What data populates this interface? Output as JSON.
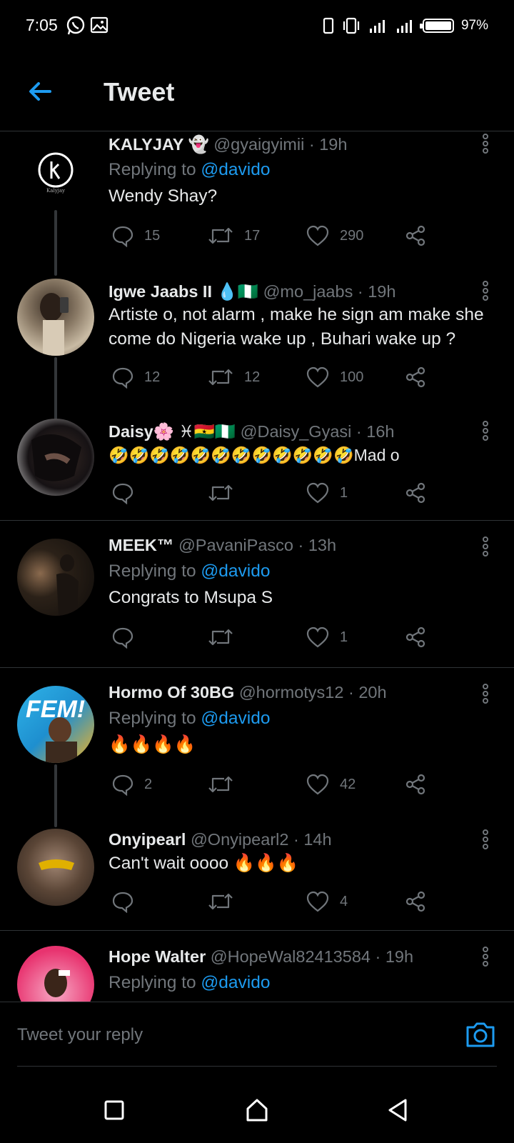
{
  "status_bar": {
    "time": "7:05",
    "battery_text": "97%",
    "left_icons": [
      "whatsapp-icon",
      "image-icon"
    ],
    "right_icons": [
      "phone-outline-icon",
      "vibrate-icon",
      "signal-4g-icon",
      "signal-icon",
      "battery-icon"
    ]
  },
  "header": {
    "title": "Tweet",
    "back_icon": "arrow-left-icon"
  },
  "tweets": [
    {
      "name": "KALYJAY 👻",
      "handle": "@gyaigyimii",
      "time": "· 19h",
      "replying_prefix": "Replying to ",
      "replying_to": "@davido",
      "text": "Wendy Shay?",
      "replies": "15",
      "retweets": "17",
      "likes": "290"
    },
    {
      "name": "Igwe Jaabs II 💧🇳🇬",
      "handle": "@mo_jaabs",
      "time": "· 19h",
      "text": "Artiste o, not alarm , make he sign am make she come do Nigeria wake up , Buhari wake up ?",
      "replies": "12",
      "retweets": "12",
      "likes": "100"
    },
    {
      "name": "Daisy🌸 ♓🇬🇭🇳🇬",
      "handle": "@Daisy_Gyasi",
      "time": "· 16h",
      "text": "🤣🤣🤣🤣🤣🤣🤣🤣🤣🤣🤣🤣Mad o",
      "replies": "",
      "retweets": "",
      "likes": "1"
    },
    {
      "name": "MEEK™",
      "handle": "@PavaniPasco",
      "time": "· 13h",
      "replying_prefix": "Replying to ",
      "replying_to": "@davido",
      "text": "Congrats  to Msupa S",
      "replies": "",
      "retweets": "",
      "likes": "1"
    },
    {
      "name": "Hormo Of 30BG",
      "handle": "@hormotys12",
      "time": "· 20h",
      "replying_prefix": "Replying to ",
      "replying_to": "@davido",
      "text": "🔥🔥🔥🔥",
      "replies": "2",
      "retweets": "",
      "likes": "42"
    },
    {
      "name": "Onyipearl",
      "handle": "@Onyipearl2",
      "time": "· 14h",
      "text": "Can't wait oooo 🔥🔥🔥",
      "replies": "",
      "retweets": "",
      "likes": "4"
    },
    {
      "name": "Hope Walter",
      "handle": "@HopeWal82413584",
      "time": "· 19h",
      "replying_prefix": "Replying to ",
      "replying_to": "@davido"
    }
  ],
  "reply_bar": {
    "placeholder": "Tweet your reply",
    "camera_icon": "camera-icon"
  },
  "nav_bar": {
    "icons": [
      "recents-square-icon",
      "home-icon",
      "back-triangle-icon"
    ]
  },
  "colors": {
    "background": "#000000",
    "accent": "#1d9bf0",
    "secondary_text": "#71767b",
    "primary_text": "#e7e9ea",
    "divider": "#2f3336"
  }
}
